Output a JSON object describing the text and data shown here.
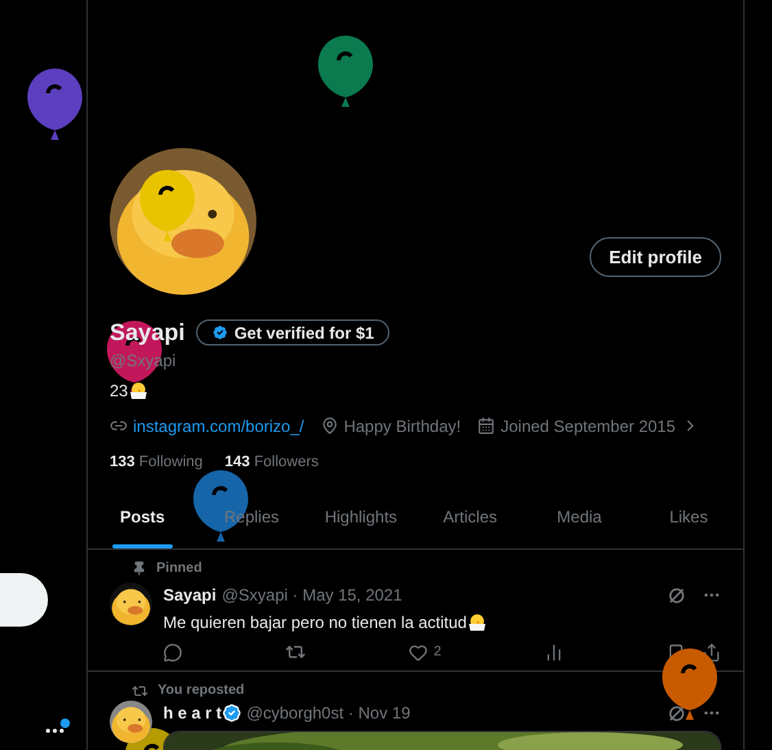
{
  "profile": {
    "name": "Sayapi",
    "verify_button": "Get verified for $1",
    "handle": "@Sxyapi",
    "bio": "23",
    "edit_button": "Edit profile",
    "link": "instagram.com/borizo_/",
    "birthday": "Happy Birthday!",
    "joined": "Joined September 2015",
    "following_count": "133",
    "following_label": "Following",
    "followers_count": "143",
    "followers_label": "Followers"
  },
  "tabs": [
    {
      "label": "Posts",
      "selected": true
    },
    {
      "label": "Replies",
      "selected": false
    },
    {
      "label": "Highlights",
      "selected": false
    },
    {
      "label": "Articles",
      "selected": false
    },
    {
      "label": "Media",
      "selected": false
    },
    {
      "label": "Likes",
      "selected": false
    }
  ],
  "posts": [
    {
      "context": "Pinned",
      "kind": "pinned",
      "name": "Sayapi",
      "verified": false,
      "meta": "@Sxyapi · May 15, 2021",
      "text": "Me quieren bajar pero no tienen la actitud",
      "likes": "2"
    },
    {
      "context": "You reposted",
      "kind": "repost",
      "name": "h e a r t",
      "verified": true,
      "meta": "@cyborgh0st · Nov 19"
    }
  ],
  "balloons": [
    {
      "color": "#5b3fbf"
    },
    {
      "color": "#0b7a4f"
    },
    {
      "color": "#e8c400"
    },
    {
      "color": "#c2185b"
    },
    {
      "color": "#1565a8"
    },
    {
      "color": "#c85a00"
    },
    {
      "color": "#b59a00"
    }
  ]
}
